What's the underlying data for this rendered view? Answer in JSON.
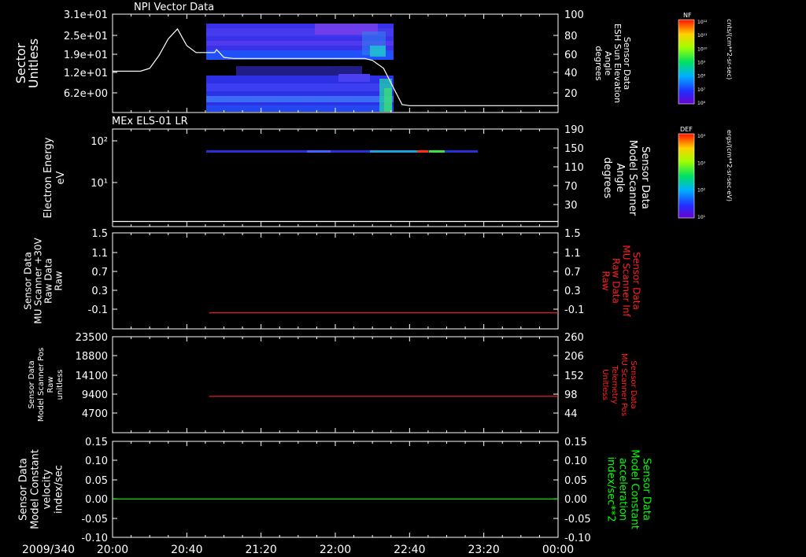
{
  "time_axis": {
    "date_label": "2009/340",
    "tick_labels": [
      "20:00",
      "20:40",
      "21:20",
      "22:00",
      "22:40",
      "23:20",
      "00:00"
    ],
    "range_minutes": [
      0,
      240
    ]
  },
  "colorbars": [
    {
      "title": "NF",
      "unit_label": "cnts/(cm**2-sr-sec)",
      "tick_labels": [
        "10¹²",
        "10¹¹",
        "10¹⁰",
        "10⁹",
        "10⁸",
        "10⁷",
        "10⁶"
      ]
    },
    {
      "title": "DEF",
      "unit_label": "ergs/(cm**2-sr-sec-eV)",
      "tick_labels": [
        "10⁴",
        "10³",
        "10²",
        "10¹"
      ]
    }
  ],
  "panels": [
    {
      "title": "NPI Vector Data",
      "left_label_lines": [
        "Sector",
        "Unitless"
      ],
      "left_ticks": [
        "3.1e+01",
        "2.5e+01",
        "1.9e+01",
        "1.2e+01",
        "6.2e+00"
      ],
      "right_label_lines": [
        "Sensor Data",
        "ESH Sun Elevation",
        "Angle",
        "degrees"
      ],
      "right_ticks": [
        "100",
        "80",
        "60",
        "40",
        "20"
      ],
      "right_label_color": "#ffffff"
    },
    {
      "title": "MEx ELS-01 LR",
      "left_label_lines": [
        "Electron Energy",
        "eV"
      ],
      "left_ticks": [
        "10²",
        "10¹"
      ],
      "right_label_lines": [
        "Sensor Data",
        "Model Scanner",
        "Angle",
        "degrees"
      ],
      "right_ticks": [
        "190",
        "150",
        "110",
        "70",
        "30"
      ],
      "right_label_color": "#ffffff"
    },
    {
      "title": "",
      "left_label_lines": [
        "Sensor Data",
        "MU Scanner +30V",
        "Raw Data",
        "Raw"
      ],
      "left_ticks": [
        "1.5",
        "1.1",
        "0.7",
        "0.3",
        "-0.1"
      ],
      "right_label_lines": [
        "Sensor Data",
        "MU Scanner Inf",
        "Raw Data",
        "Raw"
      ],
      "right_ticks": [
        "1.5",
        "1.1",
        "0.7",
        "0.3",
        "-0.1"
      ],
      "right_label_color": "#ff2020"
    },
    {
      "title": "",
      "left_label_lines": [
        "Sensor Data",
        "Model Scanner Pos",
        "Raw",
        "unitless"
      ],
      "left_ticks": [
        "23500",
        "18800",
        "14100",
        "9400",
        "4700"
      ],
      "right_label_lines": [
        "Sensor Data",
        "MU Scanner Pos",
        "Telemetry",
        "Unitless"
      ],
      "right_ticks": [
        "260",
        "206",
        "152",
        "98",
        "44"
      ],
      "right_label_color": "#ff2020"
    },
    {
      "title": "",
      "left_label_lines": [
        "Sensor Data",
        "Model Constant",
        "velocity",
        "index/sec"
      ],
      "left_ticks": [
        "0.15",
        "0.10",
        "0.05",
        "0.00",
        "-0.05",
        "-0.10"
      ],
      "right_label_lines": [
        "Sensor Data",
        "Model Constant",
        "acceleration",
        "index/sec**2"
      ],
      "right_ticks": [
        "0.15",
        "0.10",
        "0.05",
        "0.00",
        "-0.05",
        "-0.10"
      ],
      "right_label_color": "#00ff00"
    }
  ],
  "chart_data": [
    {
      "type": "heatmap",
      "title": "NPI Vector Data",
      "ylabel": "Sector Unitless",
      "y2label": "Sensor Data ESH Sun Elevation Angle degrees",
      "x_range_minutes": [
        0,
        240
      ],
      "ylim_right": [
        0,
        100
      ],
      "heatmap_blocks_minutes": [
        [
          55,
          150
        ]
      ],
      "line_series": {
        "name": "",
        "color": "#ffffff",
        "x_minutes": [
          0,
          15,
          20,
          25,
          30,
          35,
          40,
          45,
          55,
          56,
          60,
          65,
          70,
          80,
          100,
          120,
          130,
          136,
          140,
          146,
          150,
          156,
          160,
          240
        ],
        "y": [
          42,
          42,
          45,
          58,
          75,
          85,
          68,
          61,
          61,
          64,
          56,
          55,
          55,
          55,
          55,
          55,
          55,
          55,
          53,
          45,
          30,
          8,
          7,
          7
        ]
      }
    },
    {
      "type": "heatmap",
      "title": "MEx ELS-01 LR",
      "ylabel": "Electron Energy eV",
      "y2label": "Sensor Data Model Scanner Angle degrees",
      "x_range_minutes": [
        0,
        240
      ],
      "ylim_right": [
        0,
        190
      ],
      "energy_band_minutes": [
        52,
        196
      ],
      "line_series": {
        "name": "",
        "color": "#ffffff",
        "x_minutes": [
          0,
          240
        ],
        "y": [
          10,
          10
        ]
      }
    },
    {
      "type": "line",
      "ylabel": "Sensor Data MU Scanner +30V Raw Data Raw",
      "y2label": "Sensor Data MU Scanner Inf Raw Data Raw",
      "ylim": [
        -0.3,
        1.5
      ],
      "series": [
        {
          "name": "",
          "color": "#ff2020",
          "x_minutes": [
            52,
            240
          ],
          "y": [
            0,
            0
          ]
        }
      ]
    },
    {
      "type": "line",
      "ylabel": "Sensor Data Model Scanner Pos Raw unitless",
      "y2label": "Sensor Data MU Scanner Pos Telemetry Unitless",
      "ylim": [
        0,
        23500
      ],
      "y2lim": [
        0,
        260
      ],
      "series": [
        {
          "name": "",
          "color": "#ff2020",
          "x_minutes": [
            52,
            240
          ],
          "y": [
            8900,
            8900
          ]
        }
      ]
    },
    {
      "type": "line",
      "ylabel": "Sensor Data Model Constant velocity index/sec",
      "y2label": "Sensor Data Model Constant acceleration index/sec**2",
      "ylim": [
        -0.1,
        0.15
      ],
      "series": [
        {
          "name": "",
          "color": "#00ff00",
          "x_minutes": [
            0,
            240
          ],
          "y": [
            0,
            0
          ]
        }
      ]
    }
  ]
}
